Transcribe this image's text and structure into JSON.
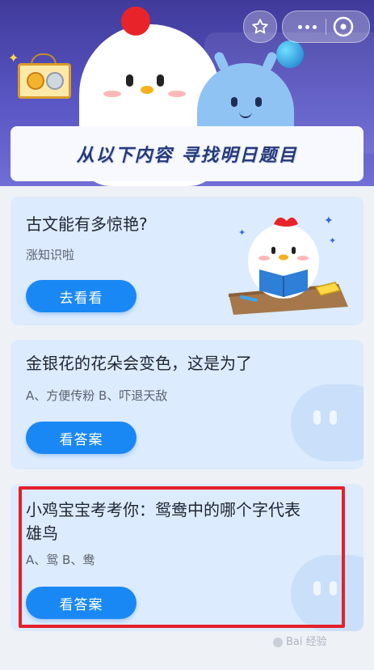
{
  "header": {
    "fav_icon": "star-icon",
    "more_icon": "more-dots-icon",
    "close_icon": "close-circle-icon",
    "title": "从以下内容  寻找明日题目"
  },
  "cards": [
    {
      "title": "古文能有多惊艳?",
      "subtitle": "涨知识啦",
      "button": "去看看"
    },
    {
      "title": "金银花的花朵会变色，这是为了",
      "options": "A、方便传粉    B、吓退天敌",
      "button": "看答案"
    },
    {
      "title_line1": "小鸡宝宝考考你：鸳鸯中的哪个字代表",
      "title_line2": "雄鸟",
      "options": "A、鸳    B、鸯",
      "button": "看答案"
    }
  ],
  "watermark": "Bai 经验",
  "colors": {
    "accent": "#1a88f4",
    "card_bg": "#dcebfd",
    "highlight": "#e4202b",
    "hero_bg": "#4b47b0"
  }
}
